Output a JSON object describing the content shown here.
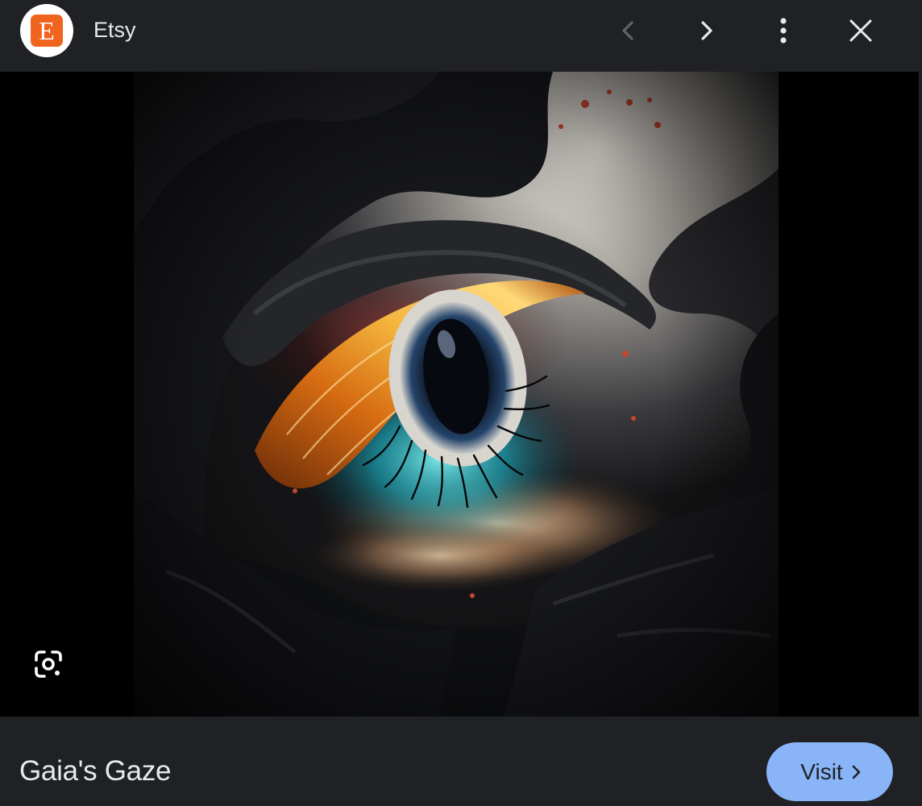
{
  "header": {
    "source_logo_letter": "E",
    "source_name": "Etsy",
    "icons": {
      "prev": "chevron-left-icon",
      "next": "chevron-right-icon",
      "more": "more-vertical-icon",
      "close": "close-icon"
    }
  },
  "image": {
    "alt": "Gaia's Gaze"
  },
  "lens": {
    "icon": "lens-icon"
  },
  "footer": {
    "title": "Gaia's Gaze",
    "visit_label": "Visit"
  },
  "colors": {
    "background": "#202124",
    "text": "#e8eaed",
    "accent": "#8ab4f8",
    "etsy_orange": "#f1641e"
  }
}
